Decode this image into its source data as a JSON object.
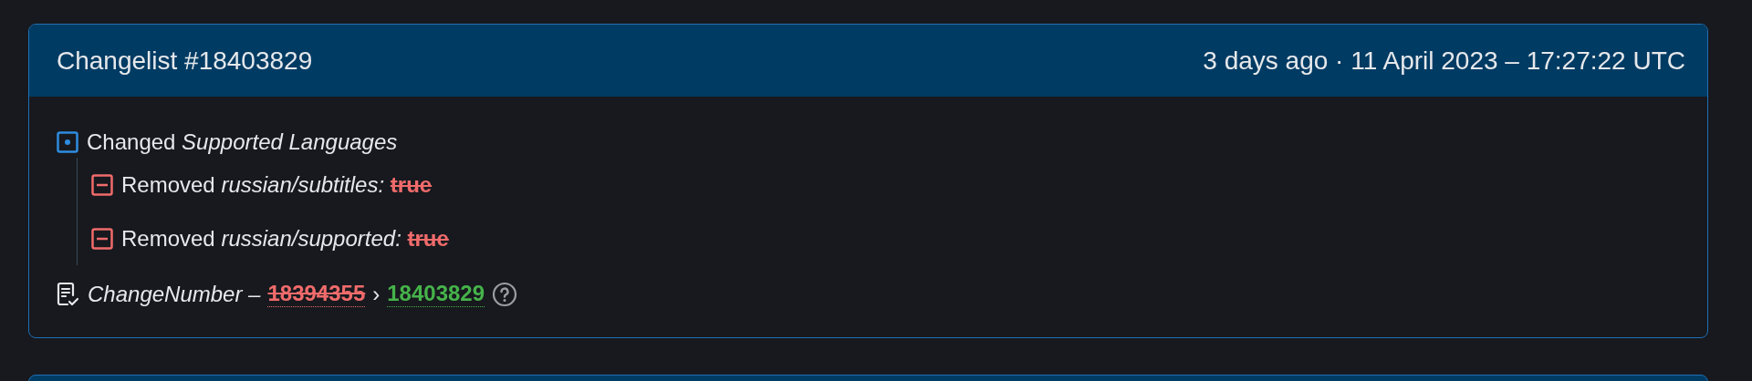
{
  "changelist": {
    "title": "Changelist #18403829",
    "time": "3 days ago · 11 April 2023 – 17:27:22 UTC",
    "changes": [
      {
        "kind": "changed",
        "verb": "Changed",
        "key": "Supported Languages",
        "children": [
          {
            "kind": "removed",
            "verb": "Removed",
            "key": "russian/subtitles:",
            "value": "true"
          },
          {
            "kind": "removed",
            "verb": "Removed",
            "key": "russian/supported:",
            "value": "true"
          }
        ]
      }
    ],
    "change_number": {
      "label": "ChangeNumber –",
      "old": "18394355",
      "separator": "›",
      "new": "18403829"
    }
  }
}
